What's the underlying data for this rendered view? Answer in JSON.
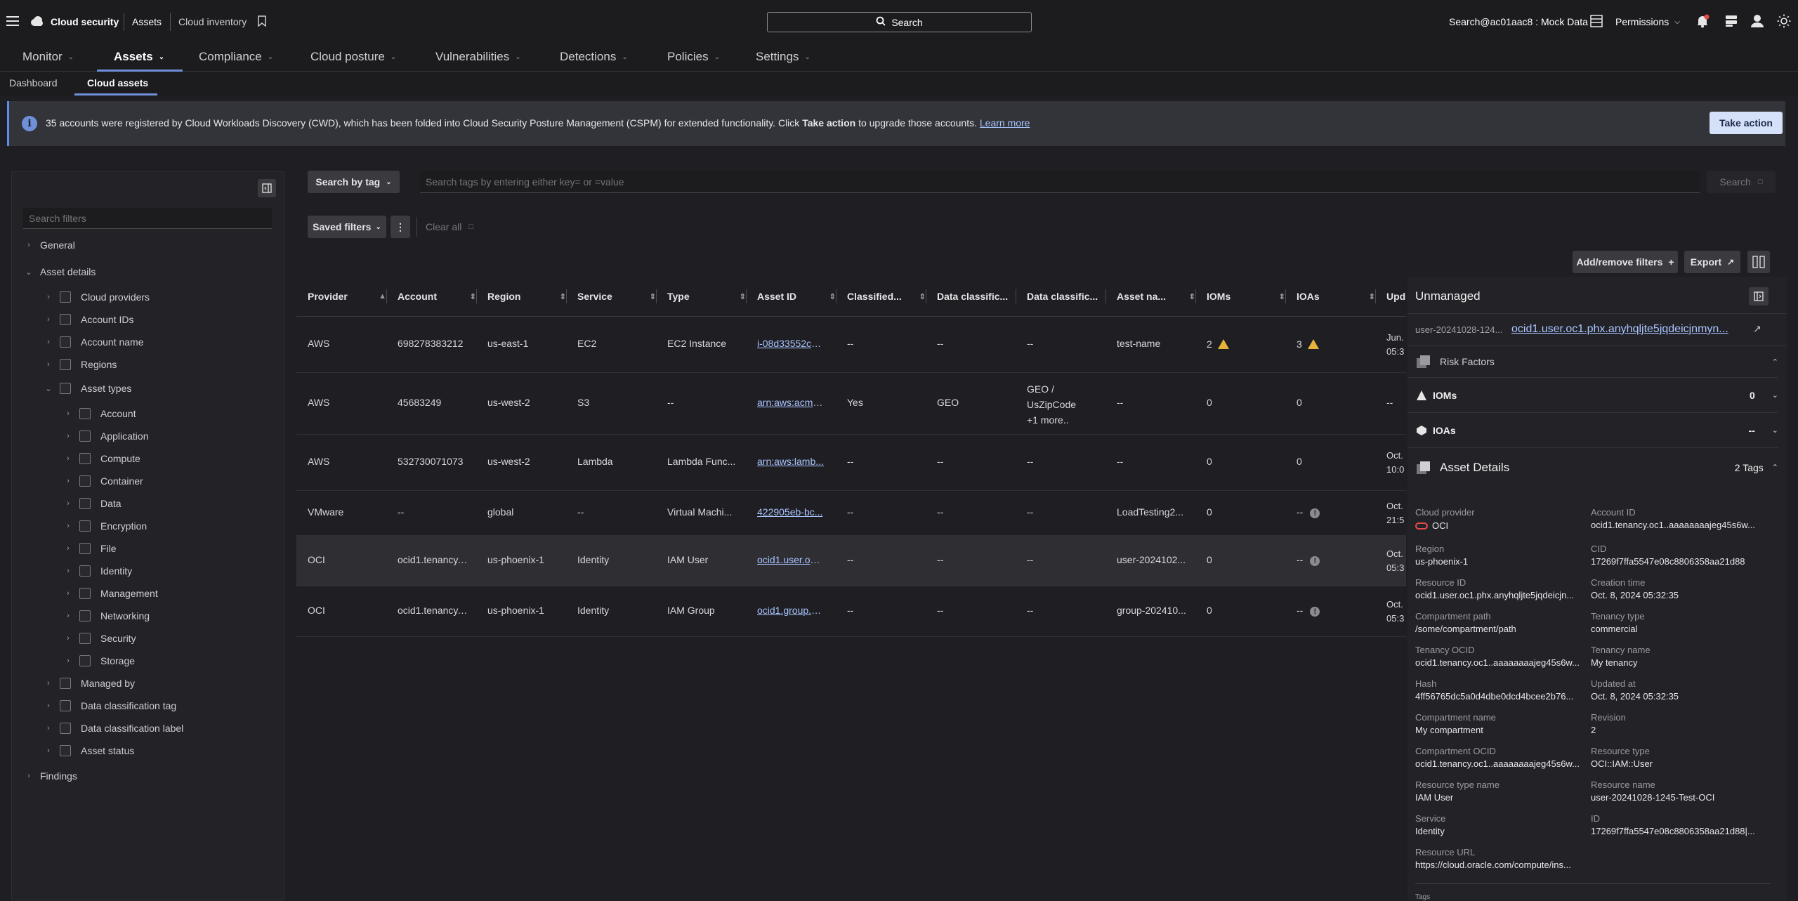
{
  "topbar": {
    "brand": "Cloud security",
    "crumb1": "Assets",
    "crumb2": "Cloud inventory",
    "search": "Search",
    "tenant": "Search@ac01aac8 : Mock Data",
    "permissions": "Permissions"
  },
  "nav": {
    "items": [
      "Monitor",
      "Assets",
      "Compliance",
      "Cloud posture",
      "Vulnerabilities",
      "Detections",
      "Policies",
      "Settings"
    ]
  },
  "subnav": {
    "dashboard": "Dashboard",
    "cloud_assets": "Cloud assets"
  },
  "banner": {
    "text1": "35 accounts were registered by Cloud Workloads Discovery (CWD), which has been folded into Cloud Security Posture Management (CSPM) for extended functionality. Click ",
    "bold": "Take action",
    "text2": " to upgrade those accounts. ",
    "link": "Learn more",
    "button": "Take action"
  },
  "sidebar": {
    "search_placeholder": "Search filters",
    "general": "General",
    "asset_details": "Asset details",
    "items": [
      "Cloud providers",
      "Account IDs",
      "Account name",
      "Regions",
      "Asset types"
    ],
    "asset_types": [
      "Account",
      "Application",
      "Compute",
      "Container",
      "Data",
      "Encryption",
      "File",
      "Identity",
      "Management",
      "Networking",
      "Security",
      "Storage"
    ],
    "items2": [
      "Managed by",
      "Data classification tag",
      "Data classification label",
      "Asset status"
    ],
    "findings": "Findings"
  },
  "toolbar": {
    "search_by_tag": "Search by tag",
    "tag_placeholder": "Search tags by entering either key= or =value",
    "search": "Search",
    "saved_filters": "Saved filters",
    "clear_all": "Clear all",
    "add_remove": "Add/remove filters",
    "export": "Export"
  },
  "table": {
    "headers": [
      "Provider",
      "Account",
      "Region",
      "Service",
      "Type",
      "Asset ID",
      "Classified...",
      "Data classific...",
      "Data classific...",
      "Asset na...",
      "IOMs",
      "IOAs",
      "Upd"
    ],
    "rows": [
      [
        "AWS",
        "698278383212",
        "us-east-1",
        "EC2",
        "EC2 Instance",
        "i-08d33552c7...",
        "--",
        "--",
        "--",
        "test-name",
        "2",
        "3",
        "Jun.\n05:3"
      ],
      [
        "AWS",
        "45683249",
        "us-west-2",
        "S3",
        "--",
        "arn:aws:acm:u...",
        "Yes",
        "GEO",
        "GEO /\nUsZipCode\n+1 more..",
        "--",
        "0",
        "0",
        "--"
      ],
      [
        "AWS",
        "532730071073",
        "us-west-2",
        "Lambda",
        "Lambda Func...",
        "arn:aws:lamb...",
        "--",
        "--",
        "--",
        "--",
        "0",
        "0",
        "Oct.\n10:0"
      ],
      [
        "VMware",
        "--",
        "global",
        "--",
        "Virtual Machi...",
        "422905eb-bc...",
        "--",
        "--",
        "--",
        "LoadTesting2...",
        "0",
        "--",
        "Oct.\n21:5"
      ],
      [
        "OCI",
        "ocid1.tenancy....",
        "us-phoenix-1",
        "Identity",
        "IAM User",
        "ocid1.user.oc1...",
        "--",
        "--",
        "--",
        "user-2024102...",
        "0",
        "--",
        "Oct.\n05:3"
      ],
      [
        "OCI",
        "ocid1.tenancy....",
        "us-phoenix-1",
        "Identity",
        "IAM Group",
        "ocid1.group.o...",
        "--",
        "--",
        "--",
        "group-202410...",
        "0",
        "--",
        "Oct.\n05:3"
      ]
    ]
  },
  "panel": {
    "title": "Unmanaged",
    "sub_prefix": "user-20241028-124...",
    "sub_link": "ocid1.user.oc1.phx.anyhqljte5jqdeicjnmyn...",
    "risk_factors": "Risk Factors",
    "ioms": "IOMs",
    "ioms_val": "0",
    "ioas": "IOAs",
    "ioas_val": "--",
    "asset_details": "Asset Details",
    "tags_count": "2 Tags",
    "tags_label": "Tags",
    "fields_left": [
      [
        "Cloud provider",
        "OCI"
      ],
      [
        "Region",
        "us-phoenix-1"
      ],
      [
        "Resource ID",
        "ocid1.user.oc1.phx.anyhqljte5jqdeicjn..."
      ],
      [
        "Compartment path",
        "/some/compartment/path"
      ],
      [
        "Tenancy OCID",
        "ocid1.tenancy.oc1..aaaaaaaajeg45s6w..."
      ],
      [
        "Hash",
        "4ff56765dc5a0d4dbe0dcd4bcee2b76..."
      ],
      [
        "Compartment name",
        "My compartment"
      ],
      [
        "Compartment OCID",
        "ocid1.tenancy.oc1..aaaaaaaajeg45s6w..."
      ],
      [
        "Resource type name",
        "IAM User"
      ],
      [
        "Service",
        "Identity"
      ],
      [
        "Resource URL",
        "https://cloud.oracle.com/compute/ins..."
      ]
    ],
    "fields_right": [
      [
        "Account ID",
        "ocid1.tenancy.oc1..aaaaaaaajeg45s6w..."
      ],
      [
        "CID",
        "17269f7ffa5547e08c8806358aa21d88"
      ],
      [
        "Creation time",
        "Oct. 8, 2024 05:32:35"
      ],
      [
        "Tenancy type",
        "commercial"
      ],
      [
        "Tenancy name",
        "My tenancy"
      ],
      [
        "Updated at",
        "Oct. 8, 2024 05:32:35"
      ],
      [
        "Revision",
        "2"
      ],
      [
        "Resource type",
        "OCI::IAM::User"
      ],
      [
        "Resource name",
        "user-20241028-1245-Test-OCI"
      ],
      [
        "ID",
        "17269f7ffa5547e08c8806358aa21d88|..."
      ]
    ]
  }
}
